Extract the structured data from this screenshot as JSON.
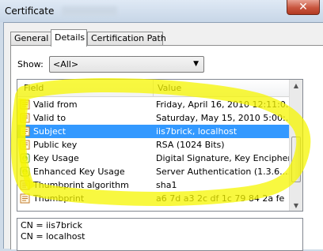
{
  "window": {
    "title": "Certificate"
  },
  "tabs": [
    {
      "label": "General",
      "active": false
    },
    {
      "label": "Details",
      "active": true
    },
    {
      "label": "Certification Path",
      "active": false
    }
  ],
  "show": {
    "label": "Show:",
    "value": "<All>"
  },
  "table": {
    "headers": [
      "Field",
      "Value"
    ],
    "rows": [
      {
        "field": "Valid from",
        "value": "Friday, April 16, 2010 12:11:0...",
        "icon": "cert-field-icon"
      },
      {
        "field": "Valid to",
        "value": "Saturday, May 15, 2010 5:00:...",
        "icon": "cert-field-icon"
      },
      {
        "field": "Subject",
        "value": "iis7brick, localhost",
        "icon": "cert-field-icon",
        "selected": true
      },
      {
        "field": "Public key",
        "value": "RSA (1024 Bits)",
        "icon": "cert-field-icon"
      },
      {
        "field": "Key Usage",
        "value": "Digital Signature, Key Encipher...",
        "icon": "extension-icon"
      },
      {
        "field": "Enhanced Key Usage",
        "value": "Server Authentication (1.3.6....",
        "icon": "extension-icon"
      },
      {
        "field": "Thumbprint algorithm",
        "value": "sha1",
        "icon": "cert-field-icon"
      },
      {
        "field": "Thumbprint",
        "value": "a6 7d a3 2c df 1c 79 84 2a fe",
        "icon": "cert-field-icon"
      }
    ]
  },
  "detail": {
    "lines": [
      "CN = iis7brick",
      "CN = localhost"
    ]
  },
  "colors": {
    "selection": "#3399ff",
    "highlighter": "#f5f500",
    "close": "#c8553e"
  }
}
